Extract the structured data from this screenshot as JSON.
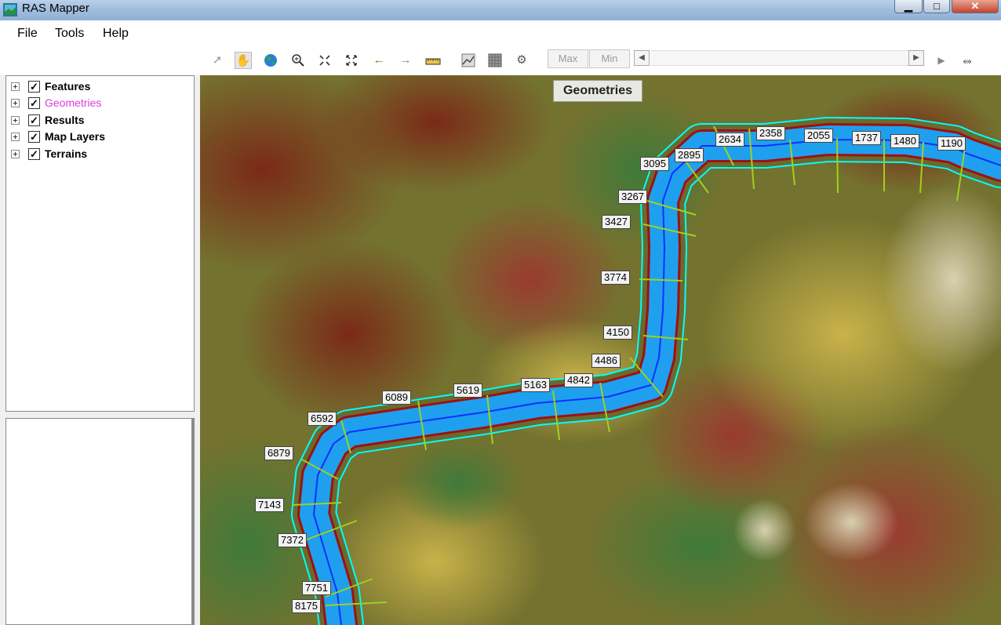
{
  "window": {
    "title": "RAS Mapper"
  },
  "menu": {
    "items": [
      "File",
      "Tools",
      "Help"
    ]
  },
  "toolbar": {
    "icons": [
      "select-arrow-icon",
      "pan-hand-icon",
      "globe-icon",
      "zoom-in-icon",
      "zoom-out-icon",
      "full-extent-icon",
      "back-arrow-icon",
      "forward-arrow-icon",
      "measure-ruler-icon",
      "profile-plot-icon",
      "raster-icon",
      "settings-icon"
    ],
    "max_label": "Max",
    "min_label": "Min"
  },
  "tree": {
    "items": [
      {
        "label": "Features",
        "checked": true
      },
      {
        "label": "Geometries",
        "checked": true,
        "highlight": "#e03ae0"
      },
      {
        "label": "Results",
        "checked": true
      },
      {
        "label": "Map Layers",
        "checked": true
      },
      {
        "label": "Terrains",
        "checked": true
      }
    ]
  },
  "map": {
    "layer_label": "Geometries",
    "cross_sections": [
      "2634",
      "2358",
      "2055",
      "1737",
      "1480",
      "1190",
      "3095",
      "2895",
      "3267",
      "3427",
      "3774",
      "4150",
      "4486",
      "4842",
      "5163",
      "5619",
      "6089",
      "6592",
      "6879",
      "7143",
      "7372",
      "7751",
      "8175"
    ],
    "colors": {
      "river": "#1ea0ee",
      "centerline": "#1030ff",
      "bank": "#00ffff",
      "xs_line": "#a0d020",
      "channel_edge": "#a01010"
    }
  }
}
